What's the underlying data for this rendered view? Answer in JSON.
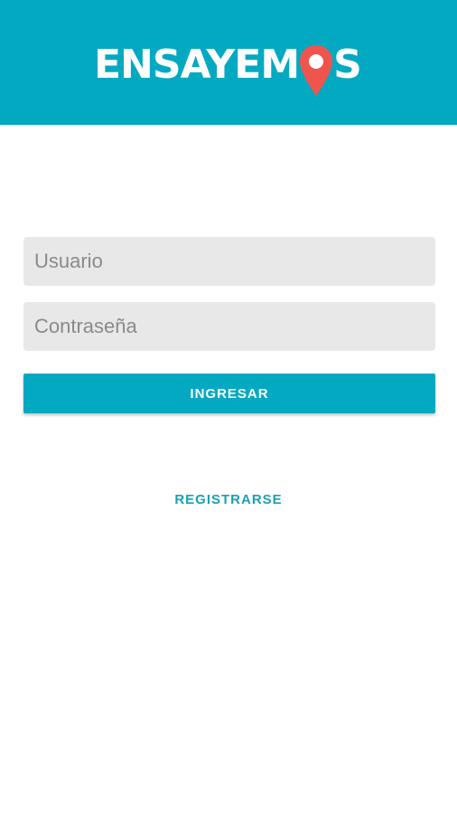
{
  "header": {
    "logo_part1": "ENSAYEM",
    "logo_part2": "S",
    "logo_icon": "map-pin-icon",
    "brand_color": "#02a9c1",
    "pin_color": "#f0544f"
  },
  "login": {
    "usuario_placeholder": "Usuario",
    "contrasena_placeholder": "Contraseña",
    "ingresar_label": "INGRESAR",
    "registrarse_label": "REGISTRARSE"
  }
}
